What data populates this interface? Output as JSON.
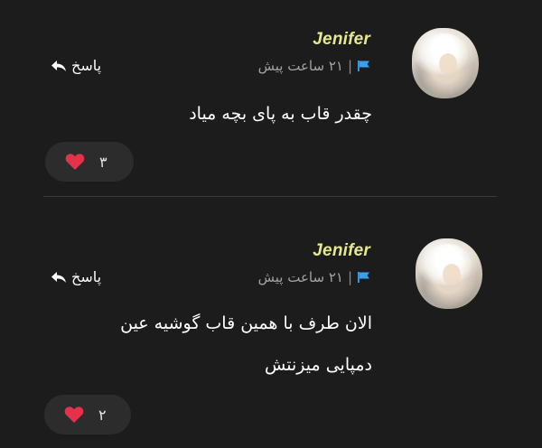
{
  "comments": [
    {
      "username": "Jenifer",
      "time": "۲۱ ساعت پیش",
      "separator": "|",
      "flag_icon": "flag-icon",
      "flag_color": "#3aa0e8",
      "reply_label": "پاسخ",
      "reply_icon": "reply-arrow-icon",
      "text_lines": [
        "چقدر قاب به پای بچه میاد"
      ],
      "likes": "۳",
      "heart_icon": "heart-icon",
      "heart_color": "#e5324a"
    },
    {
      "username": "Jenifer",
      "time": "۲۱ ساعت پیش",
      "separator": "|",
      "flag_icon": "flag-icon",
      "flag_color": "#3aa0e8",
      "reply_label": "پاسخ",
      "reply_icon": "reply-arrow-icon",
      "text_lines": [
        "الان طرف با همین قاب گوشیه عین",
        "دمپایی میزنتش"
      ],
      "likes": "۲",
      "heart_icon": "heart-icon",
      "heart_color": "#e5324a"
    }
  ],
  "colors": {
    "background": "#1c1c1c",
    "username": "#e6e88f",
    "pill": "#2c2c2c"
  }
}
